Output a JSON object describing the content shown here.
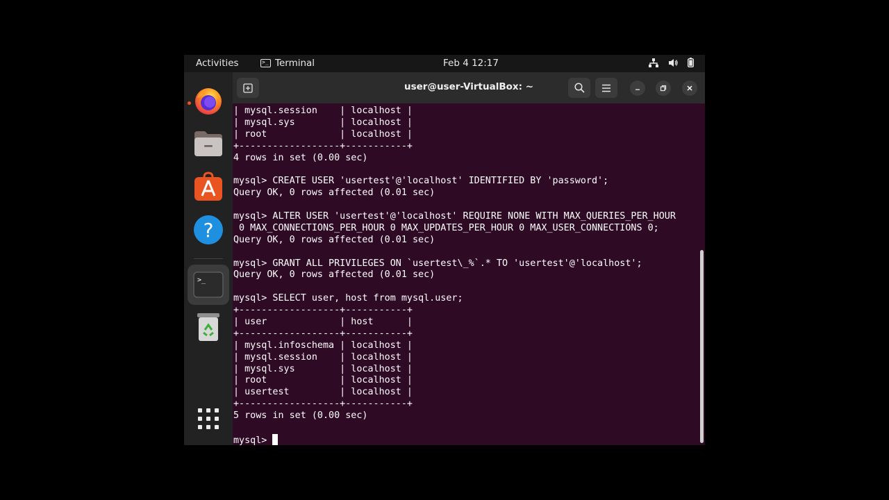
{
  "topbar": {
    "activities": "Activities",
    "app_name": "Terminal",
    "clock": "Feb 4  12:17",
    "tray_icons": [
      "network-icon",
      "volume-icon",
      "battery-icon"
    ]
  },
  "dock": {
    "items": [
      "firefox-icon",
      "files-icon",
      "app-center-icon",
      "help-icon",
      "terminal-icon",
      "trash-icon",
      "show-apps-icon"
    ]
  },
  "window": {
    "title": "user@user-VirtualBox: ~"
  },
  "terminal": {
    "lines": [
      "| mysql.session    | localhost |",
      "| mysql.sys        | localhost |",
      "| root             | localhost |",
      "+------------------+-----------+",
      "4 rows in set (0.00 sec)",
      "",
      "mysql> CREATE USER 'usertest'@'localhost' IDENTIFIED BY 'password';",
      "Query OK, 0 rows affected (0.01 sec)",
      "",
      "mysql> ALTER USER 'usertest'@'localhost' REQUIRE NONE WITH MAX_QUERIES_PER_HOUR",
      " 0 MAX_CONNECTIONS_PER_HOUR 0 MAX_UPDATES_PER_HOUR 0 MAX_USER_CONNECTIONS 0;",
      "Query OK, 0 rows affected (0.01 sec)",
      "",
      "mysql> GRANT ALL PRIVILEGES ON `usertest\\_%`.* TO 'usertest'@'localhost';",
      "Query OK, 0 rows affected (0.01 sec)",
      "",
      "mysql> SELECT user, host from mysql.user;",
      "+------------------+-----------+",
      "| user             | host      |",
      "+------------------+-----------+",
      "| mysql.infoschema | localhost |",
      "| mysql.session    | localhost |",
      "| mysql.sys        | localhost |",
      "| root             | localhost |",
      "| usertest         | localhost |",
      "+------------------+-----------+",
      "5 rows in set (0.00 sec)",
      ""
    ],
    "prompt": "mysql> "
  },
  "colors": {
    "terminal_bg": "#2f0a25",
    "accent": "#e95420"
  }
}
